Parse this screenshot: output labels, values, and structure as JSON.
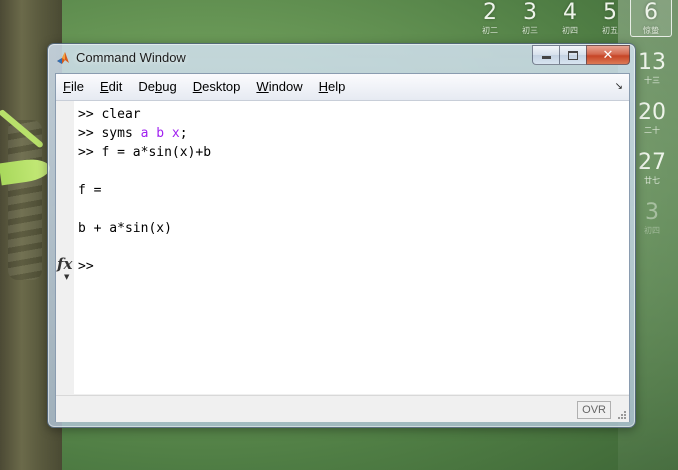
{
  "calendar": {
    "top_row": [
      {
        "day": "2",
        "lunar": "初二"
      },
      {
        "day": "3",
        "lunar": "初三"
      },
      {
        "day": "4",
        "lunar": "初四"
      },
      {
        "day": "5",
        "lunar": "初五"
      },
      {
        "day": "6",
        "lunar": "惊蛰"
      }
    ],
    "right_col": [
      {
        "day": "13",
        "lunar": "十三"
      },
      {
        "day": "20",
        "lunar": "二十"
      },
      {
        "day": "27",
        "lunar": "廿七"
      },
      {
        "day": "3",
        "lunar": "初四"
      }
    ]
  },
  "window": {
    "title": "Command Window",
    "close_glyph": "✕"
  },
  "menu": [
    {
      "accel": "F",
      "rest": "ile"
    },
    {
      "accel": "E",
      "rest": "dit"
    },
    {
      "pre": "De",
      "accel": "b",
      "rest": "ug"
    },
    {
      "accel": "D",
      "rest": "esktop"
    },
    {
      "accel": "W",
      "rest": "indow"
    },
    {
      "accel": "H",
      "rest": "elp"
    }
  ],
  "undock_glyph": "↘",
  "console": {
    "line1_prompt": ">> ",
    "line1_cmd": "clear",
    "line2_prompt": ">> ",
    "line2_cmd": "syms ",
    "line2_args": "a b x",
    "line2_end": ";",
    "line3_prompt": ">> ",
    "line3_cmd": "f = a*sin(x)+b",
    "result_name": "f =",
    "result_value": "b + a*sin(x)",
    "current_prompt": ">>"
  },
  "fx_label": "fx",
  "fx_arrow": "▼",
  "status": {
    "ovr": "OVR"
  }
}
